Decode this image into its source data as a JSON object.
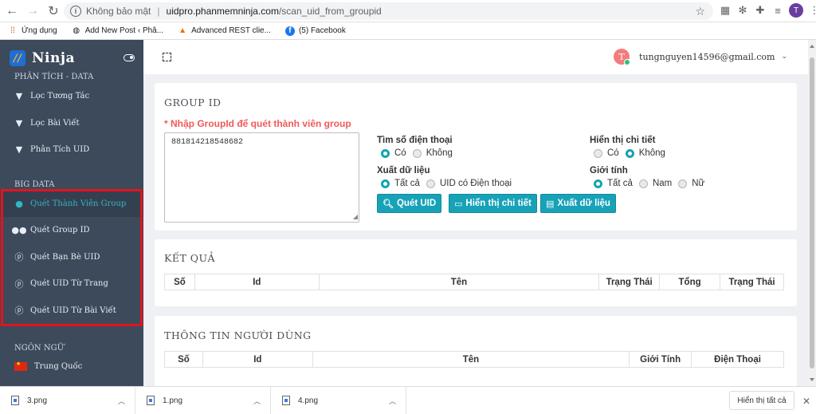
{
  "browser": {
    "security_label": "Không bảo mật",
    "host": "uidpro.phanmemninja.com",
    "path": "/scan_uid_from_groupid",
    "profile_initial": "T",
    "bookmarks": [
      {
        "icon": "apps-grid-icon",
        "label": "Ứng dụng"
      },
      {
        "icon": "globe-icon",
        "label": "Add New Post ‹ Phâ..."
      },
      {
        "icon": "rest-client-icon",
        "label": "Advanced REST clie..."
      },
      {
        "icon": "facebook-icon",
        "label": "(5) Facebook"
      }
    ]
  },
  "sidebar": {
    "brand": "Ninja",
    "section_analysis": "PHÂN TÍCH - DATA",
    "analysis_items": [
      {
        "icon": "filter-icon",
        "label": "Lọc Tương Tác"
      },
      {
        "icon": "filter-icon",
        "label": "Lọc Bài Viết"
      },
      {
        "icon": "filter-icon",
        "label": "Phân Tích UID"
      }
    ],
    "section_bigdata": "BIG DATA",
    "bigdata_items": [
      {
        "icon": "user-icon",
        "label": "Quét Thành Viên Group",
        "active": true
      },
      {
        "icon": "users-icon",
        "label": "Quét Group ID"
      },
      {
        "icon": "pinterest-icon",
        "label": "Quét Bạn Bè UID"
      },
      {
        "icon": "pinterest-icon",
        "label": "Quét UID Từ Trang"
      },
      {
        "icon": "pinterest-icon",
        "label": "Quét UID Từ Bài Viết"
      }
    ],
    "section_language": "NGÔN NGỮ",
    "language": "Trung Quốc",
    "highlight_color": "#e3141b",
    "accent_color": "#33b6c3"
  },
  "header": {
    "avatar_initial": "T",
    "user_email": "tungnguyen14596@gmail.com"
  },
  "group_card": {
    "title": "GROUP ID",
    "required_label": "* Nhập GroupId để quét thành viên group",
    "group_id_value": "881814218548682",
    "find_phone_label": "Tìm số điện thoại",
    "find_phone_options": [
      "Có",
      "Không"
    ],
    "find_phone_selected": "Có",
    "export_label": "Xuất dữ liệu",
    "export_options": [
      "Tất cả",
      "UID có Điện thoại"
    ],
    "export_selected": "Tất cả",
    "show_detail_label": "Hiển thị chi tiết",
    "show_detail_options": [
      "Có",
      "Không"
    ],
    "show_detail_selected": "Không",
    "gender_label": "Giới tính",
    "gender_options": [
      "Tất cả",
      "Nam",
      "Nữ"
    ],
    "gender_selected": "Tất cả",
    "buttons": {
      "scan": "Quét UID",
      "show_detail": "Hiển thị chi tiết",
      "export": "Xuất dữ liệu"
    },
    "button_color": "#17a2b8"
  },
  "result_card": {
    "title": "KẾT QUẢ",
    "columns": [
      "Số",
      "Id",
      "Tên",
      "Trạng Thái",
      "Tổng",
      "Trạng Thái"
    ]
  },
  "user_info_card": {
    "title": "THÔNG TIN NGƯỜI DÙNG",
    "columns": [
      "Số",
      "Id",
      "Tên",
      "Giới Tính",
      "Điện Thoại"
    ]
  },
  "downloads": {
    "files": [
      "3.png",
      "1.png",
      "4.png"
    ],
    "show_all": "Hiển thị tất cả"
  }
}
